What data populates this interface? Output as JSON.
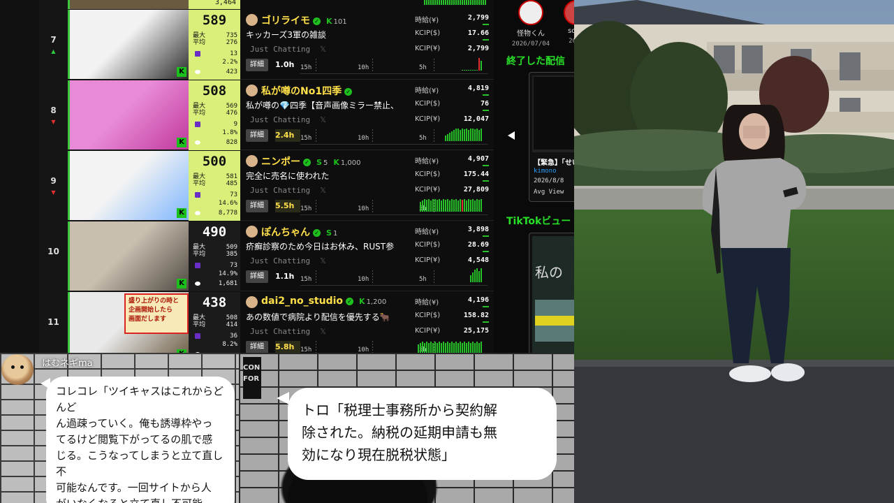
{
  "ranking": {
    "top_partial": {
      "value": "3,464"
    },
    "rows": [
      {
        "rank": "7",
        "trend": "▲",
        "trend_dir": "up",
        "viewers": "589",
        "max_label": "最大",
        "max": "735",
        "avg_label": "平均",
        "avg": "276",
        "stat3": "13",
        "stat4": "2.2%",
        "stat5": "423",
        "stats_bg": "light",
        "name": "ゴリライモ",
        "badge_k": "K",
        "badge_k_count": "101",
        "title": "キッカーズ3軍の雑談",
        "category": "Just Chatting",
        "detail": "詳細",
        "duration": "1.0h",
        "duration_hi": false,
        "t15": "15h",
        "t10": "10h",
        "t5": "5h",
        "earn_label1": "時給(¥)",
        "earn1": "2,799",
        "earn_label2": "KCIP($)",
        "earn2": "17.66",
        "earn_label3": "KCIP(¥)",
        "earn3": "2,799",
        "bar_heights": [
          1,
          1,
          1,
          1,
          1,
          1,
          1,
          1,
          18,
          14
        ],
        "bar_red": [
          false,
          false,
          false,
          false,
          false,
          false,
          false,
          false,
          true,
          false
        ]
      },
      {
        "rank": "8",
        "trend": "▼",
        "trend_dir": "down",
        "viewers": "508",
        "max_label": "最大",
        "max": "569",
        "avg_label": "平均",
        "avg": "476",
        "stat3": "9",
        "stat4": "1.8%",
        "stat5": "828",
        "stats_bg": "light",
        "name": "私が噂のNo1四季",
        "badge_k": "",
        "badge_k_count": "",
        "title": "私が噂の💎四季【音声画像ミラー禁止、",
        "category": "Just Chatting",
        "detail": "詳細",
        "duration": "2.4h",
        "duration_hi": true,
        "t15": "15h",
        "t10": "10h",
        "t5": "5h",
        "earn_label1": "時給(¥)",
        "earn1": "4,819",
        "earn_label2": "KCIP($)",
        "earn2": "76",
        "earn_label3": "KCIP(¥)",
        "earn3": "12,047",
        "bar_heights": [
          8,
          10,
          12,
          14,
          16,
          18,
          18,
          16,
          18,
          17,
          18,
          16,
          18,
          18,
          17,
          18,
          16,
          18
        ],
        "bar_red": []
      },
      {
        "rank": "9",
        "trend": "▼",
        "trend_dir": "down",
        "viewers": "500",
        "max_label": "最大",
        "max": "581",
        "avg_label": "平均",
        "avg": "485",
        "stat3": "73",
        "stat4": "14.6%",
        "stat5": "8,778",
        "stats_bg": "light",
        "name": "ニンポー",
        "badge_k": "K",
        "badge_k_count": "1,000",
        "badge_s": "S",
        "badge_s_count": "5",
        "title": "完全に売名に使われた",
        "category": "Just Chatting",
        "detail": "詳細",
        "duration": "5.5h",
        "duration_hi": true,
        "t15": "15h",
        "t10": "10h",
        "t5": "5h",
        "earn_label1": "時給(¥)",
        "earn1": "4,907",
        "earn_label2": "KCIP($)",
        "earn2": "175.44",
        "earn_label3": "KCIP(¥)",
        "earn3": "27,809",
        "bar_heights": [
          14,
          16,
          18,
          17,
          18,
          16,
          18,
          18,
          17,
          18,
          16,
          18,
          17,
          18,
          16,
          18,
          17,
          18,
          16,
          18,
          17,
          18,
          16,
          18,
          17,
          18,
          16,
          18,
          17,
          18
        ],
        "bar_red": [
          false,
          false,
          false,
          false,
          false,
          false,
          false,
          false,
          false,
          false,
          false,
          false,
          false,
          false,
          false,
          false,
          false,
          false,
          false,
          false,
          true,
          false
        ]
      },
      {
        "rank": "10",
        "trend": "",
        "trend_dir": "",
        "viewers": "490",
        "max_label": "最大",
        "max": "509",
        "avg_label": "平均",
        "avg": "385",
        "stat3": "73",
        "stat4": "14.9%",
        "stat5": "1,681",
        "stats_bg": "dark",
        "name": "ぽんちゃん",
        "badge_k": "",
        "badge_k_count": "",
        "badge_s": "S",
        "badge_s_count": "1",
        "title": "疥癬診察のため今日はお休み、RUST参",
        "category": "Just Chatting",
        "detail": "詳細",
        "duration": "1.1h",
        "duration_hi": false,
        "t15": "15h",
        "t10": "10h",
        "t5": "5h",
        "earn_label1": "時給(¥)",
        "earn1": "3,898",
        "earn_label2": "KCIP($)",
        "earn2": "28.69",
        "earn_label3": "KCIP(¥)",
        "earn3": "4,548",
        "bar_heights": [
          10,
          14,
          18,
          20,
          16,
          20
        ],
        "bar_red": []
      },
      {
        "rank": "11",
        "trend": "",
        "trend_dir": "",
        "viewers": "438",
        "max_label": "最大",
        "max": "508",
        "avg_label": "平均",
        "avg": "414",
        "stat3": "36",
        "stat4": "8.2%",
        "stat5": "",
        "stats_bg": "dark",
        "name": "dai2_no_studio",
        "badge_k": "K",
        "badge_k_count": "1,200",
        "title": "あの数値で病院より配信を優先する🐂",
        "category": "Just Chatting",
        "detail": "詳細",
        "duration": "5.8h",
        "duration_hi": true,
        "t15": "15h",
        "t10": "10h",
        "t5": "5h",
        "earn_label1": "時給(¥)",
        "earn1": "4,196",
        "earn_label2": "KCIP($)",
        "earn2": "158.82",
        "earn_label3": "KCIP(¥)",
        "earn3": "25,175",
        "bar_heights": [
          12,
          14,
          16,
          14,
          16,
          14,
          16,
          14,
          16,
          14,
          16,
          14,
          16,
          14,
          16,
          14,
          16,
          14,
          16,
          14,
          16,
          14,
          16,
          14,
          16,
          14,
          16,
          14,
          16,
          14,
          16
        ],
        "bar_red": []
      }
    ]
  },
  "thumb_overlays": {
    "row11_line1": "盛り上がりの時と",
    "row11_line2": "企画開始したら",
    "row11_line3": "画面だします"
  },
  "side": {
    "user1_name": "怪物くん",
    "user1_date": "2026/07/04",
    "user2_name": "soph",
    "user2_date": "2026",
    "ended_heading": "終了した配信",
    "card_title": "【緊急】「せい",
    "card_channel": "kimono",
    "card_date": "2026/8/8",
    "card_meta": "Avg View",
    "tiktok_heading": "TikTokビュー",
    "card2_text": "私の"
  },
  "bottom": {
    "left_user": "はむネギma",
    "left_bubble": "コレコレ「ツイキャスはこれからどんど\nん過疎っていく。俺も誘導枠やっ\nてるけど閲覧下がってるの肌で感\nじる。こうなってしまうと立て直し不\n可能なんです。一回サイトから人\nがいなくなると立て直し不可能。\nこれはニコニコ生放送がそれを証",
    "mid_bubble": "トロ「税理士事務所から契約解\n除された。納税の延期申請も無\n効になり現在脱税状態」",
    "mid_side_text": "CON\nFOR"
  },
  "colors": {
    "accent_green": "#27c227",
    "name_yellow": "#ffe04a",
    "stats_green": "#d8f07a"
  }
}
